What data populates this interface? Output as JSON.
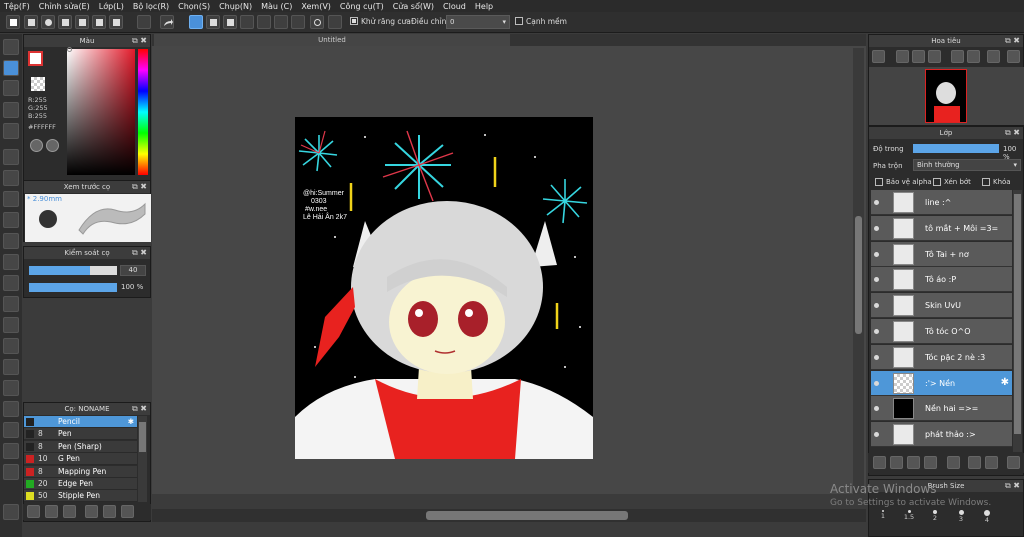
{
  "menu": [
    "Tệp(F)",
    "Chỉnh sửa(E)",
    "Lớp(L)",
    "Bộ lọc(R)",
    "Chọn(S)",
    "Chụp(N)",
    "Màu (C)",
    "Xem(V)",
    "Công cụ(T)",
    "Cửa sổ(W)",
    "Cloud",
    "Help"
  ],
  "toolbar": {
    "antialias_label": "Khử răng cưa",
    "adjust_label": "Điều chỉnh",
    "adjust_value": "0",
    "snap_label": "Cạnh mềm"
  },
  "color_panel": {
    "title": "Màu",
    "r": "R:255",
    "g": "G:255",
    "b": "B:255",
    "hex": "#FFFFFF"
  },
  "brush_preview": {
    "title": "Xem trước cọ",
    "size": "2.90mm"
  },
  "brush_control": {
    "title": "Kiểm soát cọ",
    "size_value": "40",
    "opacity_value": "100 %"
  },
  "brush_list": {
    "title": "Cọ: NONAME",
    "items": [
      {
        "size": "",
        "name": "Pencil",
        "color": "#222222",
        "selected": true
      },
      {
        "size": "8",
        "name": "Pen",
        "color": "#222222"
      },
      {
        "size": "8",
        "name": "Pen (Sharp)",
        "color": "#222222"
      },
      {
        "size": "10",
        "name": "G Pen",
        "color": "#cc2222"
      },
      {
        "size": "8",
        "name": "Mapping Pen",
        "color": "#cc2222"
      },
      {
        "size": "20",
        "name": "Edge Pen",
        "color": "#22aa22"
      },
      {
        "size": "50",
        "name": "Stipple Pen",
        "color": "#dddd22"
      }
    ]
  },
  "document": {
    "tab": "Untitled",
    "signature": "@hi:Summer\n0303\n#w.nee\nLê Hải Ân 2k7"
  },
  "navigator": {
    "title": "Hoa tiêu"
  },
  "layers_panel": {
    "title": "Lớp",
    "opacity_label": "Độ trong",
    "opacity_value": "100 %",
    "blend_label": "Pha trộn",
    "blend_value": "Bình thường",
    "protect_alpha": "Bảo vệ alpha",
    "clip": "Xén bớt",
    "lock": "Khóa",
    "layers": [
      {
        "name": "line :^"
      },
      {
        "name": "tô mắt + Môi =3="
      },
      {
        "name": "Tô Tai + nơ"
      },
      {
        "name": "Tô áo :P"
      },
      {
        "name": "Skin UvU"
      },
      {
        "name": "Tô tóc O^O"
      },
      {
        "name": "Tóc pặc 2 nè :3"
      },
      {
        "name": ":'> Nền",
        "selected": true
      },
      {
        "name": "Nền hai =>="
      },
      {
        "name": "phát thảo :>"
      }
    ]
  },
  "brush_size_panel": {
    "title": "Brush Size",
    "sizes": [
      "1",
      "1.5",
      "2",
      "3",
      "4"
    ]
  },
  "watermark": {
    "line1": "Activate Windows",
    "line2": "Go to Settings to activate Windows."
  }
}
